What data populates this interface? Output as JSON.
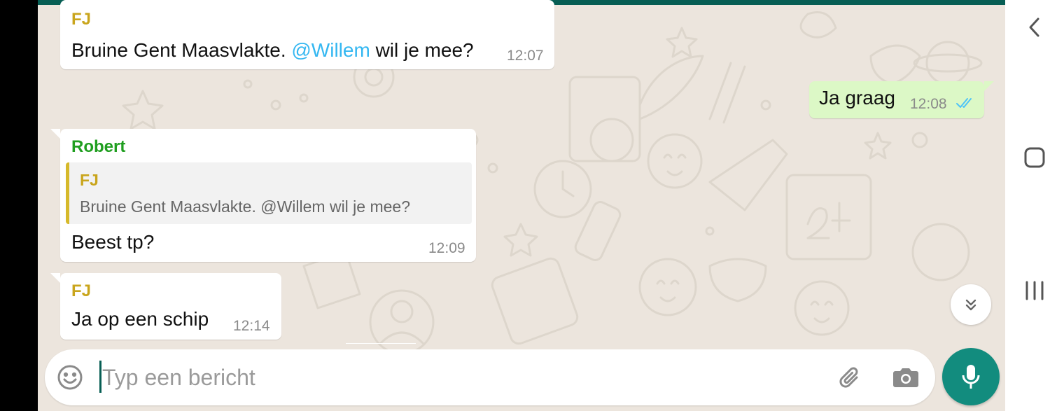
{
  "colors": {
    "chat_bg": "#ece5dd",
    "header_teal": "#075e54",
    "outgoing_bubble": "#dcf8c6",
    "mic_button": "#128c7e",
    "mention": "#34b7f1",
    "read_ticks": "#4fc3f7"
  },
  "messages": [
    {
      "sender": "FJ",
      "sender_color": "#c9a51c",
      "text_before": "Bruine Gent Maasvlakte. ",
      "mention": "@Willem",
      "text_after": " wil je mee?",
      "time": "12:07"
    },
    {
      "direction": "outgoing",
      "text": "Ja graag",
      "time": "12:08",
      "status_icon": "double-check-read-icon"
    },
    {
      "sender": "Robert",
      "sender_color": "#1f9e1f",
      "quote": {
        "sender": "FJ",
        "text": "Bruine Gent Maasvlakte. @Willem wil je mee?"
      },
      "text": "Beest tp?",
      "time": "12:09"
    },
    {
      "sender": "FJ",
      "sender_color": "#c9a51c",
      "text": "Ja op een schip",
      "time": "12:14"
    }
  ],
  "composer": {
    "placeholder": "Typ een bericht",
    "emoji_icon": "emoji-icon",
    "attach_icon": "paperclip-icon",
    "camera_icon": "camera-icon",
    "mic_icon": "microphone-icon"
  },
  "scroll_down_icon": "double-chevron-down-icon",
  "system_nav": {
    "back_icon": "back-icon",
    "home_icon": "home-icon",
    "recents_icon": "recents-icon"
  }
}
